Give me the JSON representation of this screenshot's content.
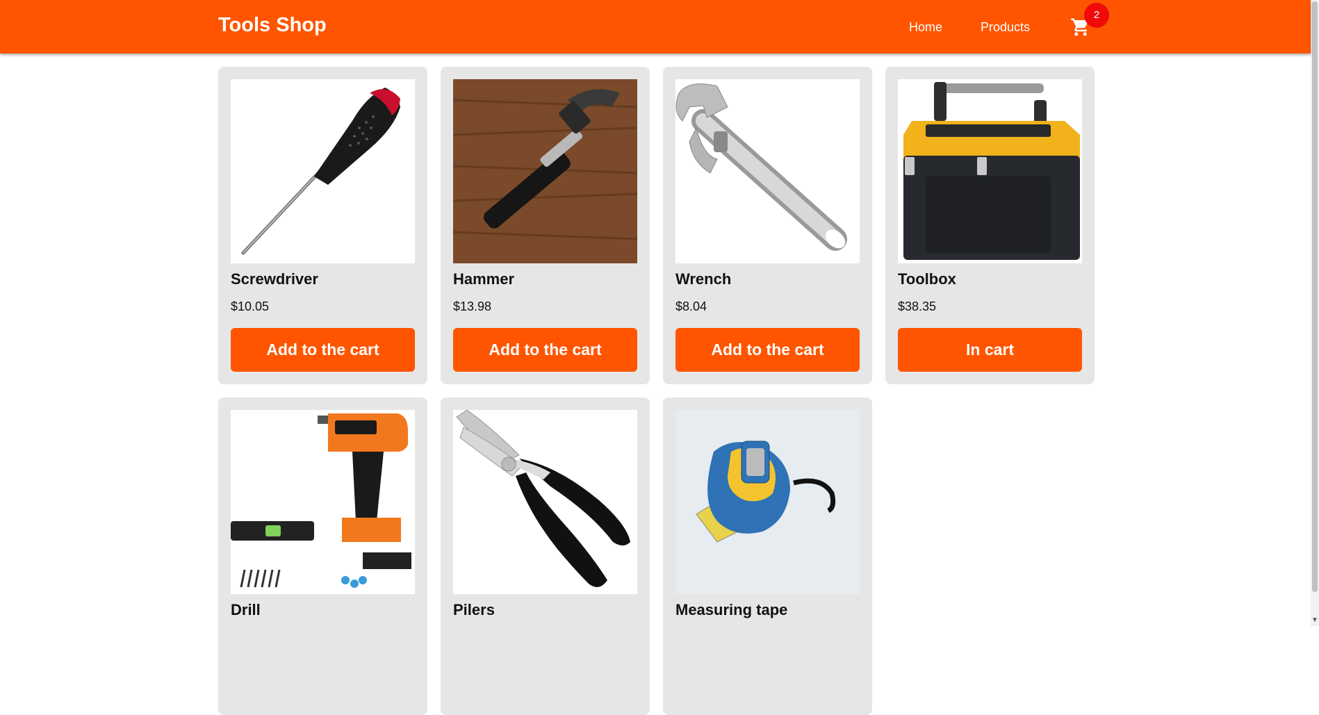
{
  "navbar": {
    "brand": "Tools Shop",
    "links": [
      "Home",
      "Products"
    ],
    "cart_count": "2",
    "cart_icon": "cart-icon"
  },
  "products": [
    {
      "name": "Screwdriver",
      "price": "$10.05",
      "button": "Add to the cart",
      "image": "screwdriver-image"
    },
    {
      "name": "Hammer",
      "price": "$13.98",
      "button": "Add to the cart",
      "image": "hammer-image"
    },
    {
      "name": "Wrench",
      "price": "$8.04",
      "button": "Add to the cart",
      "image": "wrench-image"
    },
    {
      "name": "Toolbox",
      "price": "$38.35",
      "button": "In cart",
      "image": "toolbox-image"
    },
    {
      "name": "Drill",
      "image": "drill-image"
    },
    {
      "name": "Pilers",
      "image": "pliers-image"
    },
    {
      "name": "Measuring tape",
      "image": "measuring-tape-image"
    }
  ],
  "colors": {
    "accent": "#ff5500",
    "card": "#e6e6e6",
    "badge": "#f00a0a"
  }
}
